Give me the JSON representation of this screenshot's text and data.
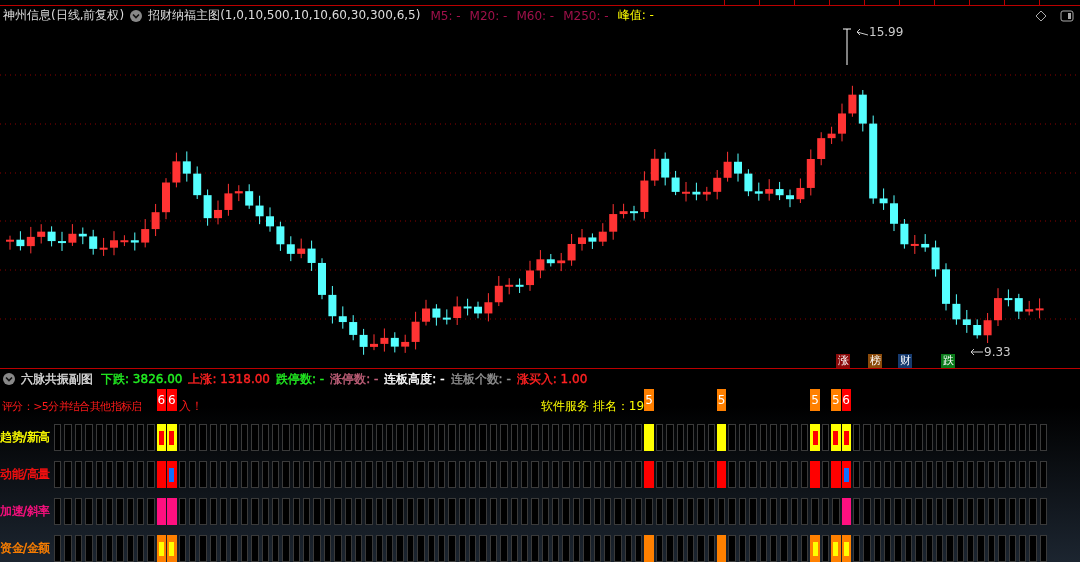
{
  "info_bar": {
    "stock": "神州信息(日线,前复权)",
    "indicator": "招财纳福主图(1,0,10,500,10,10,60,30,300,6,5)",
    "averages": [
      {
        "label": "M5: -"
      },
      {
        "label": "M20: -"
      },
      {
        "label": "M60: -"
      },
      {
        "label": "M250: -"
      }
    ],
    "peak": "峰值: -"
  },
  "chart": {
    "high_label": "15.99",
    "low_label": "9.33",
    "event_tags": [
      {
        "label": "涨",
        "color": "#8b0a0a"
      },
      {
        "label": "榜",
        "color": "#8a4a0a"
      },
      {
        "label": "财",
        "color": "#163a6e"
      },
      {
        "label": "跌",
        "color": "#0a7a1a"
      }
    ]
  },
  "sub_panel": {
    "title": "六脉共振副图",
    "stats": [
      {
        "label": "下跌: 3826.00",
        "color": "#22ee22"
      },
      {
        "label": "上涨: 1318.00",
        "color": "#ff2222"
      },
      {
        "label": "跌停数: -",
        "color": "#22ee22"
      },
      {
        "label": "涨停数: -",
        "color": "#c0607a"
      },
      {
        "label": "连板高度: -",
        "color": "#ffffff"
      },
      {
        "label": "连板个数: -",
        "color": "#909090"
      },
      {
        "label": "涨买入: 1.00",
        "color": "#ff2222"
      }
    ],
    "score_note": "评分：>5分并结合其他指标启",
    "score_note_end": "入！",
    "ranking": "软件服务 排名：19",
    "rows": [
      {
        "label": "趋势/新高",
        "color": "#ffff00"
      },
      {
        "label": "动能/高量",
        "color": "#ff1010"
      },
      {
        "label": "加速/斜率",
        "color": "#ff1080"
      },
      {
        "label": "资金/金额",
        "color": "#ff8000"
      }
    ],
    "signals": [
      {
        "score": "6",
        "color": "#ff0000",
        "trend": true,
        "trend_marked": true,
        "energy": true,
        "energy_marked": false,
        "accel": true,
        "funds": true,
        "funds_marked": true
      },
      {
        "score": "6",
        "color": "#ff0000",
        "trend": true,
        "trend_marked": true,
        "energy": true,
        "energy_marked": true,
        "accel": true,
        "funds": true,
        "funds_marked": true
      },
      {
        "score": "5",
        "color": "#ff8000",
        "trend": true,
        "trend_marked": false,
        "energy": true,
        "energy_marked": false,
        "accel": false,
        "funds": true,
        "funds_marked": false
      },
      {
        "score": "5",
        "color": "#ff8000",
        "trend": true,
        "trend_marked": false,
        "energy": true,
        "energy_marked": false,
        "accel": false,
        "funds": true,
        "funds_marked": false
      },
      {
        "score": "5",
        "color": "#ff8000",
        "trend": true,
        "trend_marked": true,
        "energy": true,
        "energy_marked": false,
        "accel": false,
        "funds": true,
        "funds_marked": true
      },
      {
        "score": "5",
        "color": "#ff8000",
        "trend": true,
        "trend_marked": true,
        "energy": true,
        "energy_marked": false,
        "accel": false,
        "funds": true,
        "funds_marked": true
      },
      {
        "score": "6",
        "color": "#ff0000",
        "trend": true,
        "trend_marked": true,
        "energy": true,
        "energy_marked": true,
        "accel": true,
        "funds": true,
        "funds_marked": true
      }
    ]
  }
}
